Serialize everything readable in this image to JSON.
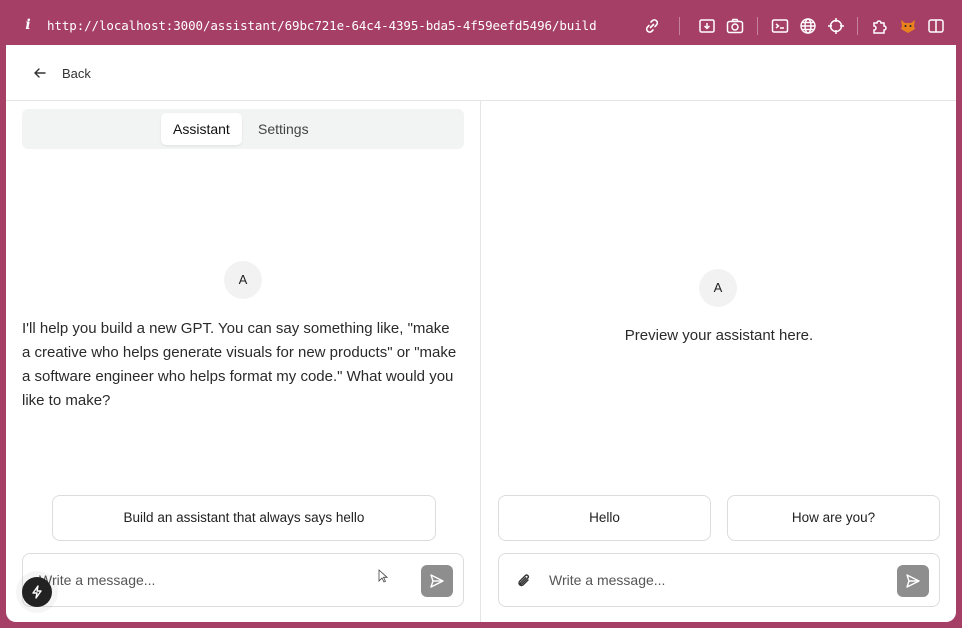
{
  "browser": {
    "url": "http://localhost:3000/assistant/69bc721e-64c4-4395-bda5-4f59eefd5496/build",
    "icons": [
      "info-icon",
      "link-icon",
      "download-icon",
      "camera-icon",
      "terminal-icon",
      "globe-icon",
      "crosshair-icon",
      "extension-icon",
      "fox-icon",
      "sidebar-icon"
    ],
    "accent": "#a53f66"
  },
  "header": {
    "back_label": "Back"
  },
  "left": {
    "tabs": [
      {
        "label": "Assistant",
        "active": true
      },
      {
        "label": "Settings",
        "active": false
      }
    ],
    "avatar_letter": "A",
    "intro": "I'll help you build a new GPT. You can say something like, \"make a creative who helps generate visuals for new products\" or \"make a software engineer who helps format my code.\" What would you like to make?",
    "suggestions": [
      "Build an assistant that always says hello"
    ],
    "composer_placeholder": "Write a message..."
  },
  "right": {
    "avatar_letter": "A",
    "preview_text": "Preview your assistant here.",
    "suggestions": [
      "Hello",
      "How are you?"
    ],
    "composer_placeholder": "Write a message..."
  }
}
